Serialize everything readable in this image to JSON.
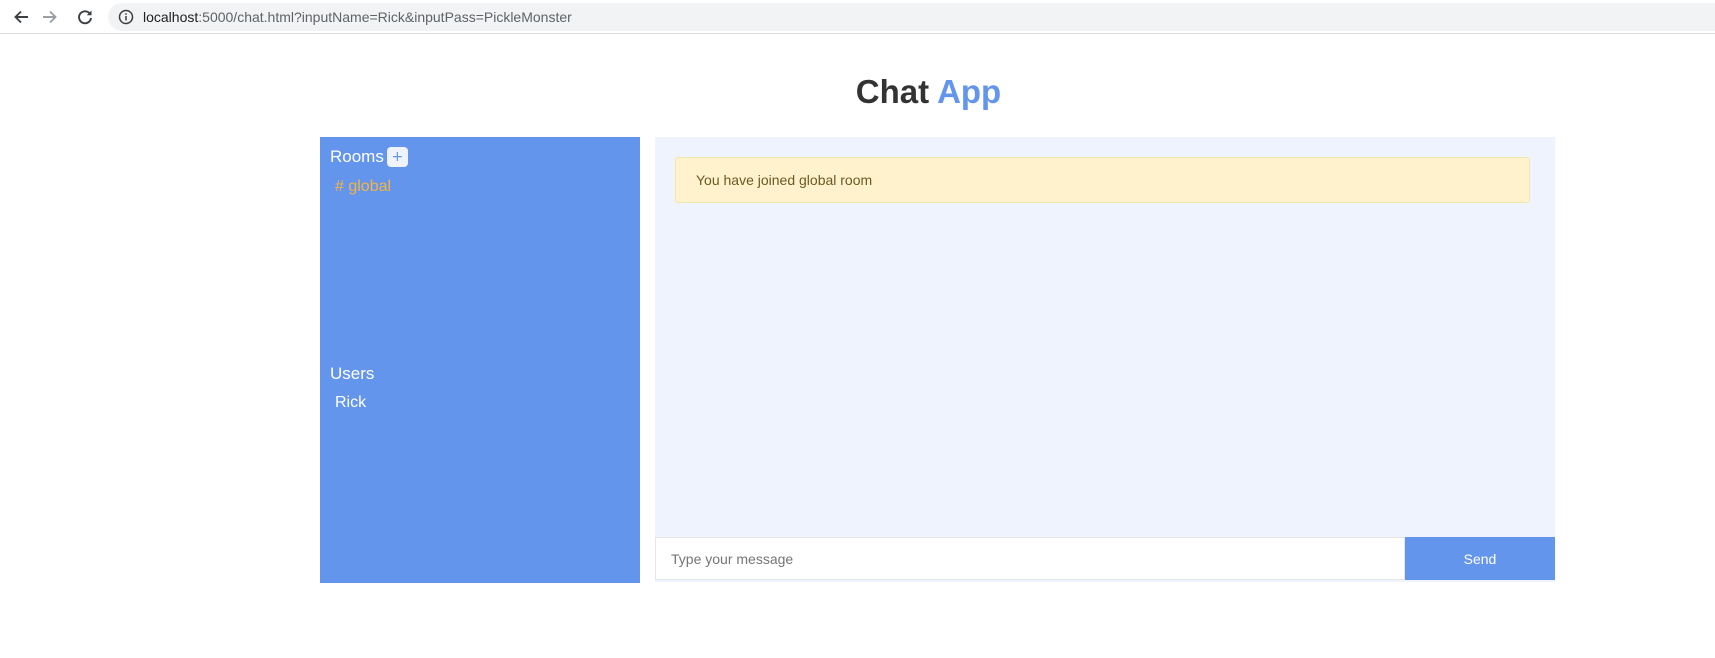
{
  "browser": {
    "url_host": "localhost",
    "url_rest": ":5000/chat.html?inputName=Rick&inputPass=PickleMonster",
    "icons": {
      "back": "arrow-left-icon",
      "forward": "arrow-right-icon",
      "reload": "reload-icon",
      "info": "info-icon"
    }
  },
  "header": {
    "title_part1": "Chat",
    "title_part2": "App"
  },
  "sidebar": {
    "rooms_heading": "Rooms",
    "add_room_label": "+",
    "rooms": [
      {
        "label": "# global",
        "active": true
      }
    ],
    "users_heading": "Users",
    "users": [
      {
        "name": "Rick"
      }
    ]
  },
  "chat": {
    "messages": [
      {
        "type": "notice",
        "text": "You have joined global room"
      }
    ],
    "input": {
      "value": "",
      "placeholder": "Type your message"
    },
    "send_label": "Send"
  },
  "colors": {
    "accent": "#6495ed",
    "active_room": "#f5b342",
    "chat_background": "#eef3fd",
    "notice_background": "#fff2cc",
    "title_dark": "#333333"
  }
}
